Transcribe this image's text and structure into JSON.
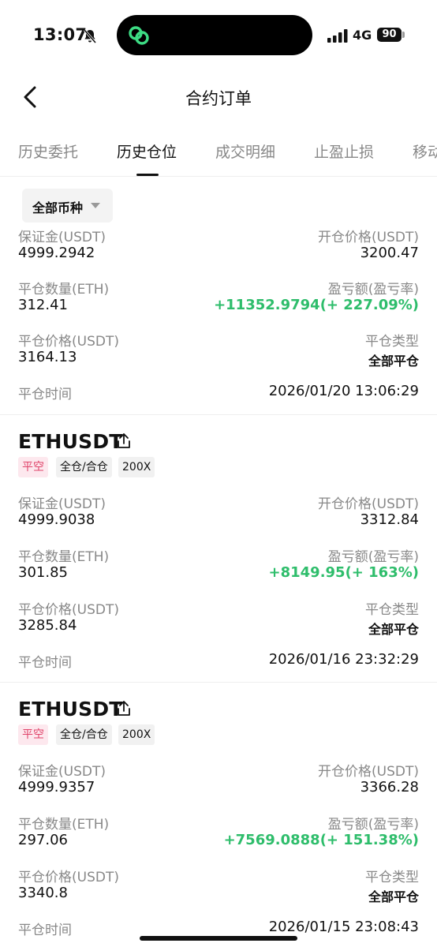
{
  "status_bar": {
    "time": "13:07",
    "network": "4G",
    "battery": "90"
  },
  "header": {
    "title": "合约订单"
  },
  "tabs": [
    {
      "label": "历史委托"
    },
    {
      "label": "历史仓位"
    },
    {
      "label": "成交明细"
    },
    {
      "label": "止盈止损"
    },
    {
      "label": "移动"
    }
  ],
  "filter": {
    "label": "全部币种"
  },
  "labels": {
    "margin": "保证金(USDT)",
    "open_price": "开仓价格(USDT)",
    "close_qty": "平仓数量(ETH)",
    "pnl": "盈亏额(盈亏率)",
    "close_price": "平仓价格(USDT)",
    "close_type": "平仓类型",
    "close_time": "平仓时间"
  },
  "orders": [
    {
      "margin": "4999.2942",
      "open_price": "3200.47",
      "close_qty": "312.41",
      "pnl": "+11352.9794(+ 227.09%)",
      "close_price": "3164.13",
      "close_type": "全部平仓",
      "close_time": "2026/01/20 13:06:29"
    },
    {
      "pair": "ETHUSDT",
      "side": "平空",
      "mode": "全仓/合仓",
      "leverage": "200X",
      "margin": "4999.9038",
      "open_price": "3312.84",
      "close_qty": "301.85",
      "pnl": "+8149.95(+ 163%)",
      "close_price": "3285.84",
      "close_type": "全部平仓",
      "close_time": "2026/01/16 23:32:29"
    },
    {
      "pair": "ETHUSDT",
      "side": "平空",
      "mode": "全仓/合仓",
      "leverage": "200X",
      "margin": "4999.9357",
      "open_price": "3366.28",
      "close_qty": "297.06",
      "pnl": "+7569.0888(+ 151.38%)",
      "close_price": "3340.8",
      "close_type": "全部平仓",
      "close_time": "2026/01/15 23:08:43"
    }
  ],
  "colors": {
    "profit": "#2ebd6b",
    "short_badge_bg": "#fde8ee",
    "short_badge_text": "#e0446a"
  }
}
